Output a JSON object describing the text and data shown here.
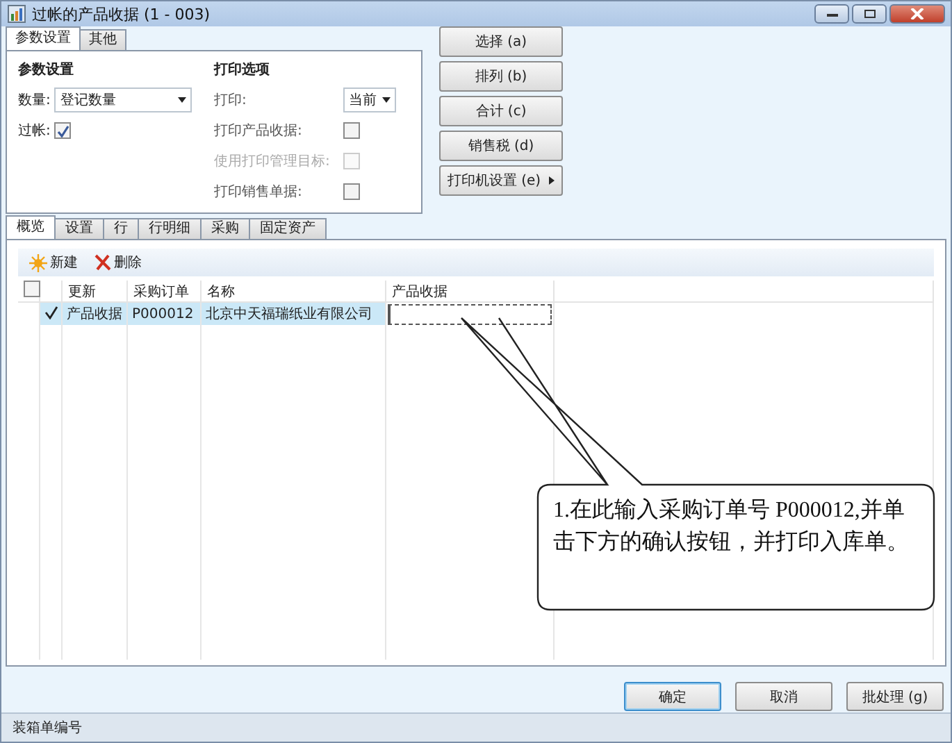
{
  "window": {
    "title": "过帐的产品收据 (1 - 003)"
  },
  "top_tabs": [
    {
      "label": "参数设置",
      "selected": true
    },
    {
      "label": "其他",
      "selected": false
    }
  ],
  "params": {
    "heading": "参数设置",
    "quantity_label": "数量:",
    "quantity_value": "登记数量",
    "post_label": "过帐:",
    "post_checked": true
  },
  "print_options": {
    "heading": "打印选项",
    "print_label": "打印:",
    "print_value": "当前",
    "items": [
      {
        "label": "打印产品收据:",
        "checked": false,
        "disabled": false
      },
      {
        "label": "使用打印管理目标:",
        "checked": false,
        "disabled": true
      },
      {
        "label": "打印销售单据:",
        "checked": false,
        "disabled": false
      }
    ]
  },
  "side_buttons": [
    {
      "label": "选择 (a)",
      "submenu": false
    },
    {
      "label": "排列 (b)",
      "submenu": false
    },
    {
      "label": "合计 (c)",
      "submenu": false
    },
    {
      "label": "销售税 (d)",
      "submenu": false
    },
    {
      "label": "打印机设置 (e)",
      "submenu": true
    }
  ],
  "tabs": [
    {
      "label": "概览",
      "selected": true
    },
    {
      "label": "设置",
      "selected": false
    },
    {
      "label": "行",
      "selected": false
    },
    {
      "label": "行明细",
      "selected": false
    },
    {
      "label": "采购",
      "selected": false
    },
    {
      "label": "固定资产",
      "selected": false
    }
  ],
  "toolbar": [
    {
      "label": "新建",
      "kind": "new"
    },
    {
      "label": "删除",
      "kind": "delete"
    }
  ],
  "table": {
    "select_all_checked": false,
    "columns": [
      "更新",
      "采购订单",
      "名称",
      "产品收据"
    ],
    "rows": [
      {
        "marked": true,
        "cells": [
          "产品收据",
          "P000012",
          "北京中天福瑞纸业有限公司",
          ""
        ]
      }
    ]
  },
  "callout": {
    "text": "1.在此输入采购订单号 P000012,并单击下方的确认按钮，并打印入库单。"
  },
  "buttons": [
    {
      "label": "确定",
      "default": true
    },
    {
      "label": "取消",
      "default": false
    },
    {
      "label": "批处理 (g)",
      "default": false
    }
  ],
  "status_bar": {
    "text": "装箱单编号"
  }
}
